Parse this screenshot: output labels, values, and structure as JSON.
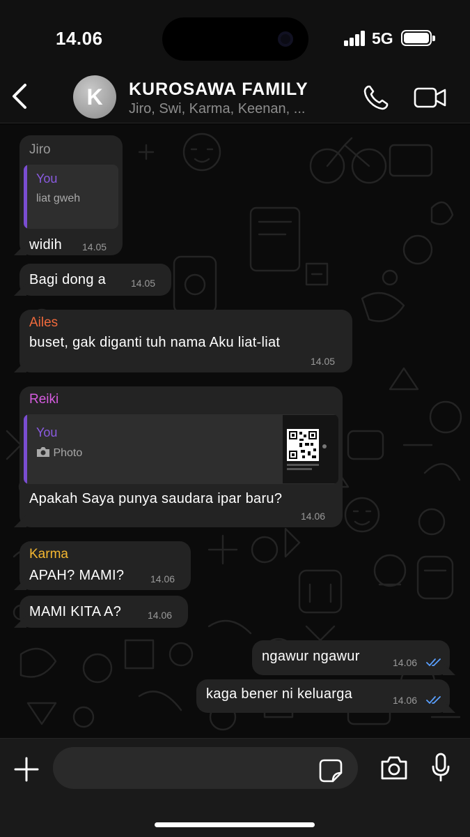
{
  "status_bar": {
    "time": "14.06",
    "network": "5G"
  },
  "header": {
    "avatar_letter": "K",
    "title": "KUROSAWA FAMILY",
    "members": "Jiro, Swi, Karma, Keenan, ..."
  },
  "messages": [
    {
      "sender": "Jiro",
      "sender_color": "#9a9a9a",
      "quote": {
        "author": "You",
        "text": "liat gweh"
      },
      "text": "widih",
      "time": "14.05"
    },
    {
      "text": "Bagi dong a",
      "time": "14.05"
    },
    {
      "sender": "Ailes",
      "sender_color": "#f06a3c",
      "text": "buset, gak diganti tuh nama Aku liat-liat",
      "time": "14.05"
    },
    {
      "sender": "Reiki",
      "sender_color": "#d65ce0",
      "quote": {
        "author": "You",
        "text": "Photo"
      },
      "text": "Apakah Saya punya saudara ipar baru?",
      "time": "14.06"
    },
    {
      "sender": "Karma",
      "sender_color": "#f5b731",
      "text": "APAH? MAMI?",
      "time": "14.06"
    },
    {
      "text": "MAMI KITA A?",
      "time": "14.06"
    },
    {
      "text": "ngawur ngawur",
      "time": "14.06",
      "outgoing": true,
      "status": "read"
    },
    {
      "text": "kaga bener ni keluarga",
      "time": "14.06",
      "outgoing": true,
      "status": "read"
    }
  ],
  "colors": {
    "quote_accent": "#7a4dd1",
    "read_ticks": "#5aa0ff",
    "bubble": "#232323"
  },
  "input_bar": {
    "icons": [
      "plus-icon",
      "sticker-icon",
      "camera-icon",
      "microphone-icon"
    ]
  }
}
